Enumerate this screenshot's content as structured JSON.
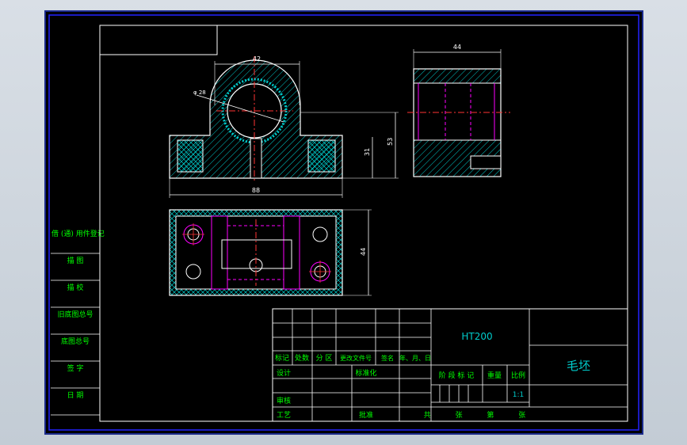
{
  "colors": {
    "border": "#ffffff",
    "outline": "#ffffff",
    "hatch": "#00cccc",
    "center_line": "#ff3333",
    "hidden_line": "#ff00ff",
    "dimension": "#ffffff",
    "table_text": "#00ff00",
    "frame_blue": "#2222ff"
  },
  "drawing": {
    "material": "HT200",
    "part_name": "毛坯",
    "scale": "1:1"
  },
  "dimensions": {
    "front_top_width": "42",
    "front_bore_dia": "φ 28",
    "front_base_width": "88",
    "front_base_height": "31",
    "front_total_height": "53",
    "side_width": "44",
    "top_depth": "44"
  },
  "left_table": {
    "rows": [
      "借 (通) 用件登记",
      "描 图",
      "描 校",
      "旧底图总号",
      "底图总号",
      "签 字",
      "日 期"
    ]
  },
  "title_block": {
    "header_labels": [
      "标记",
      "处数",
      "分 区",
      "更改文件号",
      "签名",
      "年、月、日"
    ],
    "design": "设计",
    "standardize": "标准化",
    "stage_labels": [
      "阶 段 标 记",
      "重量",
      "比例"
    ],
    "review": "审核",
    "process": "工艺",
    "approve": "批准",
    "sheets_label": "共 张 第 张"
  }
}
